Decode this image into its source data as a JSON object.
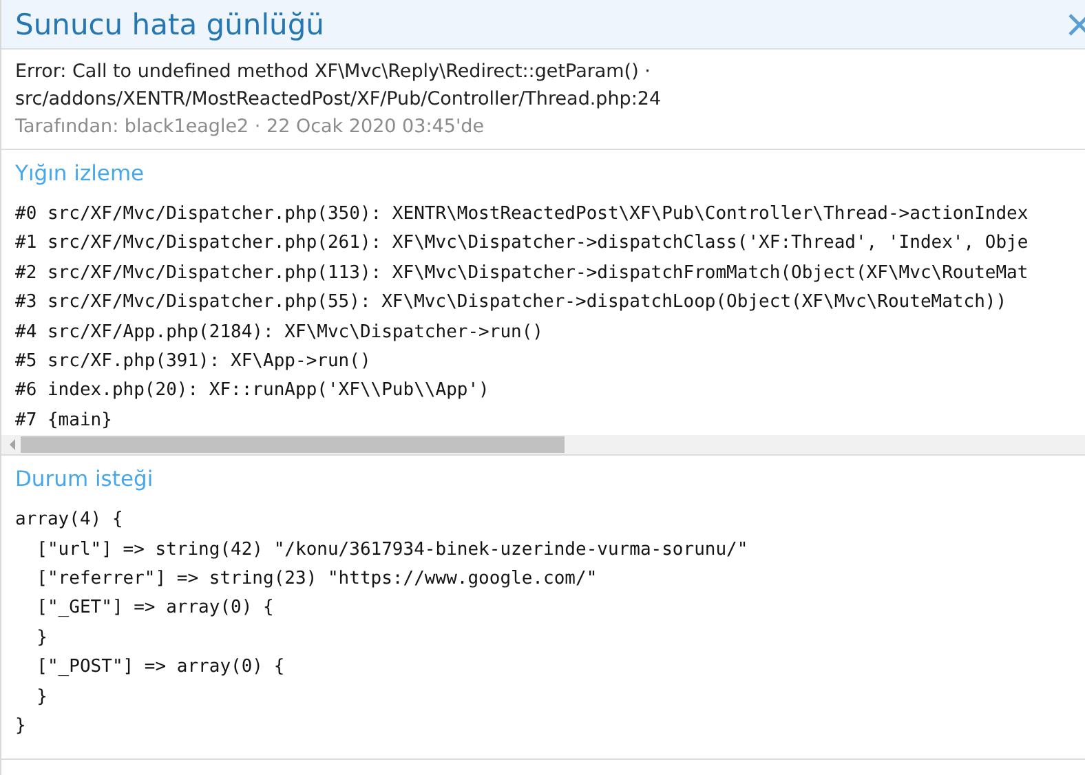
{
  "window": {
    "title": "Sunucu hata günlüğü"
  },
  "error": {
    "message": "Error: Call to undefined method XF\\Mvc\\Reply\\Redirect::getParam() · src/addons/XENTR/MostReactedPost/XF/Pub/Controller/Thread.php:24",
    "meta": "Tarafından: black1eagle2 · 22 Ocak 2020 03:45'de"
  },
  "sections": [
    {
      "title": "Yığın izleme",
      "kind": "scroll",
      "lines": [
        "#0 src/XF/Mvc/Dispatcher.php(350): XENTR\\MostReactedPost\\XF\\Pub\\Controller\\Thread->actionIndex",
        "#1 src/XF/Mvc/Dispatcher.php(261): XF\\Mvc\\Dispatcher->dispatchClass('XF:Thread', 'Index', Obje",
        "#2 src/XF/Mvc/Dispatcher.php(113): XF\\Mvc\\Dispatcher->dispatchFromMatch(Object(XF\\Mvc\\RouteMat",
        "#3 src/XF/Mvc/Dispatcher.php(55): XF\\Mvc\\Dispatcher->dispatchLoop(Object(XF\\Mvc\\RouteMatch))",
        "#4 src/XF/App.php(2184): XF\\Mvc\\Dispatcher->run()",
        "#5 src/XF.php(391): XF\\App->run()",
        "#6 index.php(20): XF::runApp('XF\\\\Pub\\\\App')",
        "#7 {main}"
      ]
    },
    {
      "title": "Durum isteği",
      "kind": "plain",
      "lines": [
        "array(4) {",
        "  [\"url\"] => string(42) \"/konu/3617934-binek-uzerinde-vurma-sorunu/\"",
        "  [\"referrer\"] => string(23) \"https://www.google.com/\"",
        "  [\"_GET\"] => array(0) {",
        "  }",
        "  [\"_POST\"] => array(0) {",
        "  }",
        "}"
      ]
    }
  ]
}
